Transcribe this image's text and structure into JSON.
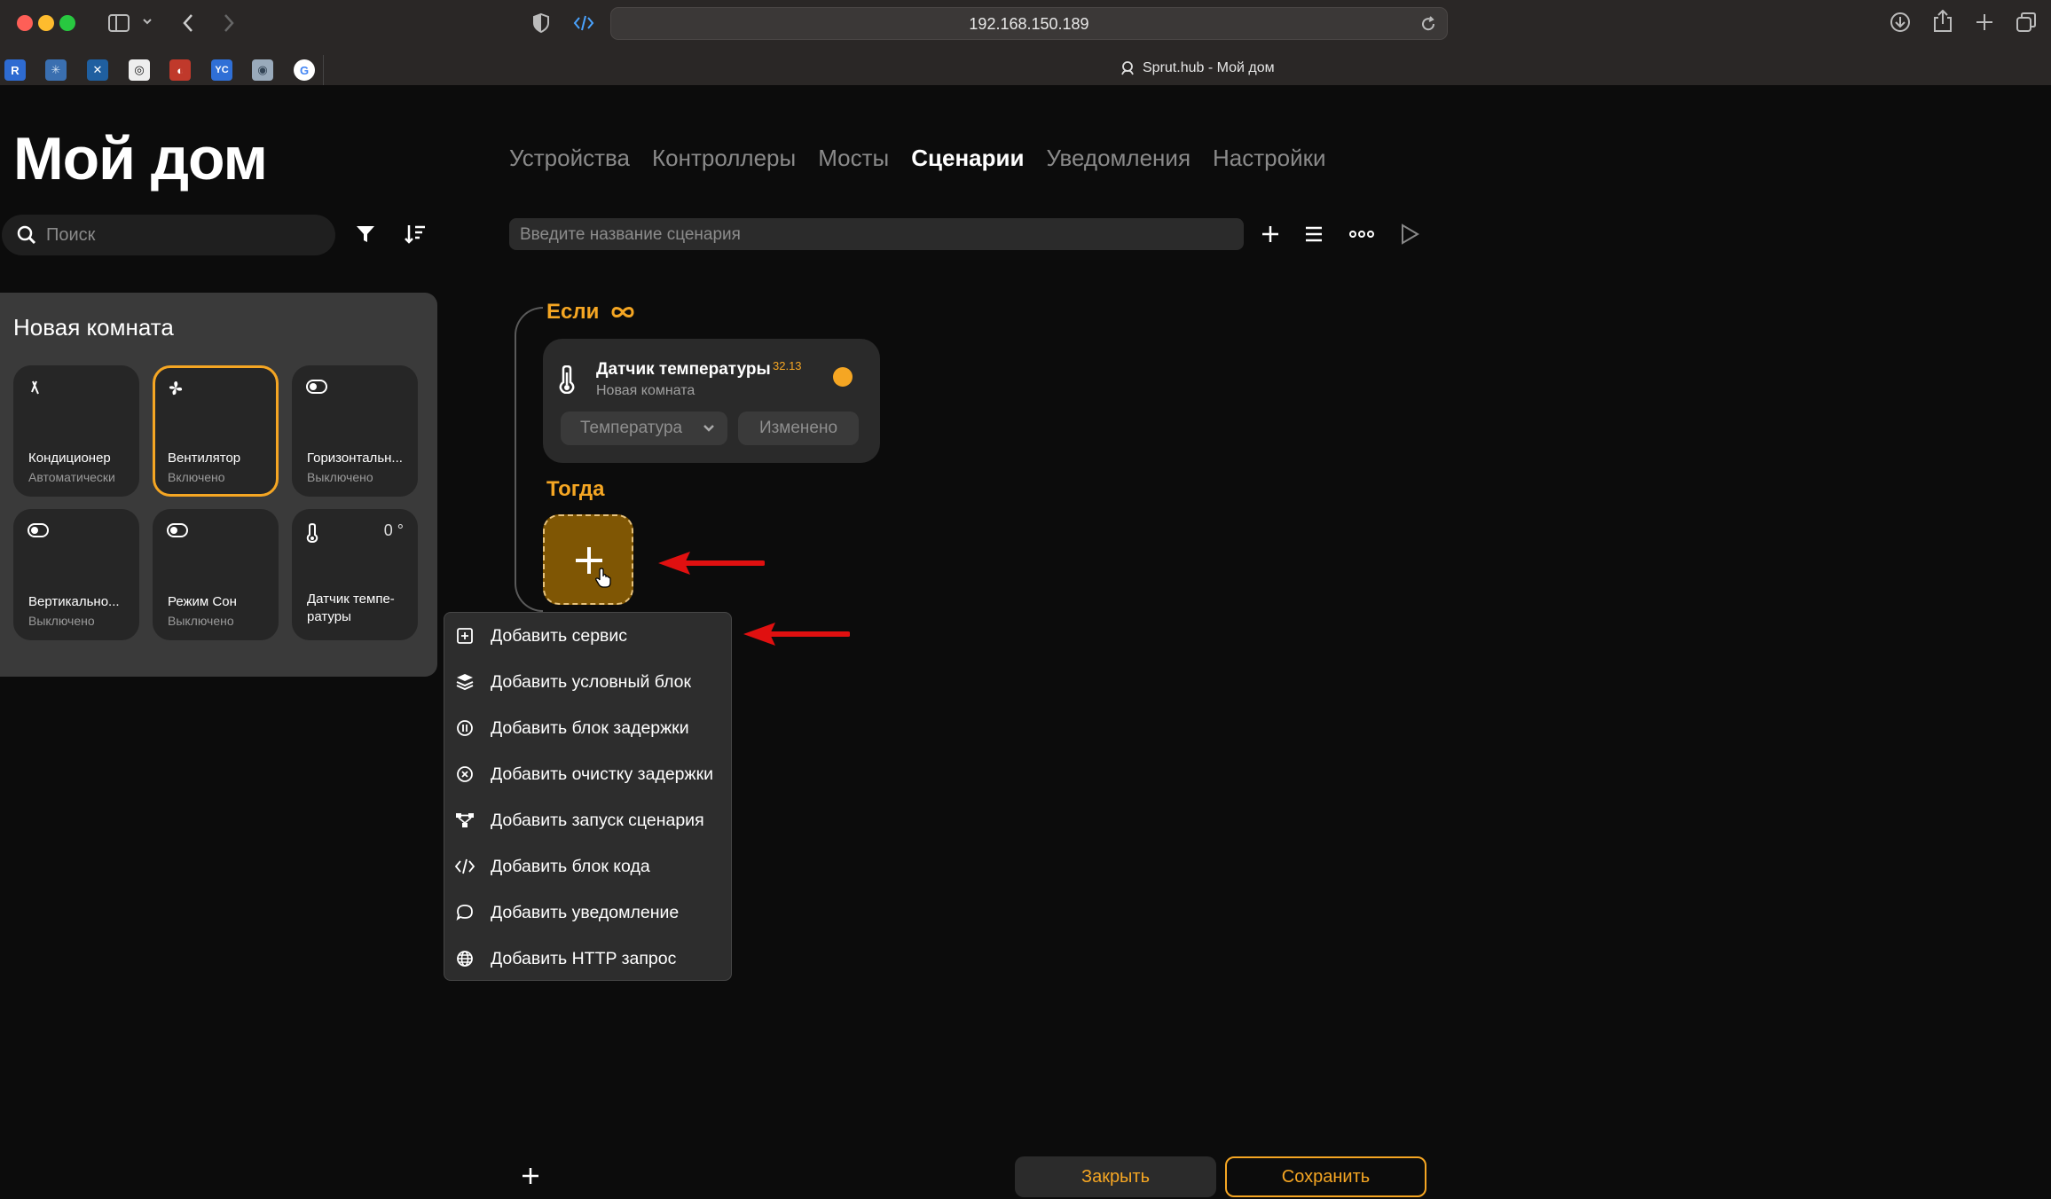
{
  "browser": {
    "url": "192.168.150.189",
    "tab_title": "Sprut.hub - Мой дом",
    "bookmarks": [
      "R",
      "✳",
      "✕",
      "◎",
      "◐",
      "YC",
      "◉",
      "G"
    ]
  },
  "app": {
    "title": "Мой дом",
    "nav": {
      "devices": "Устройства",
      "controllers": "Контроллеры",
      "bridges": "Мосты",
      "scenarios": "Сценарии",
      "notifications": "Уведомления",
      "settings": "Настройки"
    },
    "search_placeholder": "Поиск",
    "scenario_placeholder": "Введите название сценария"
  },
  "room": {
    "title": "Новая комната",
    "tiles": [
      {
        "name": "Кондиционер",
        "state": "Автоматически",
        "icon": "air-conditioner-icon"
      },
      {
        "name": "Вентилятор",
        "state": "Включено",
        "icon": "fan-icon",
        "active": true
      },
      {
        "name": "Горизонтальн...",
        "state": "Выключено",
        "icon": "toggle-icon"
      },
      {
        "name": "Вертикально...",
        "state": "Выключено",
        "icon": "toggle-icon"
      },
      {
        "name": "Режим Сон",
        "state": "Выключено",
        "icon": "toggle-icon"
      },
      {
        "name": "Датчик темпе-ратуры",
        "state": "",
        "value": "0 °",
        "icon": "thermometer-icon"
      }
    ]
  },
  "scenario": {
    "if_label": "Если",
    "then_label": "Тогда",
    "condition": {
      "device": "Датчик температуры",
      "value": "32.13",
      "room": "Новая комната",
      "characteristic": "Температура",
      "trigger": "Изменено"
    }
  },
  "menu": {
    "items": [
      {
        "label": "Добавить сервис",
        "icon": "plus-square-icon"
      },
      {
        "label": "Добавить условный блок",
        "icon": "layers-icon"
      },
      {
        "label": "Добавить блок задержки",
        "icon": "pause-circle-icon"
      },
      {
        "label": "Добавить очистку задержки",
        "icon": "x-circle-icon"
      },
      {
        "label": "Добавить запуск сценария",
        "icon": "flow-icon"
      },
      {
        "label": "Добавить блок кода",
        "icon": "code-icon"
      },
      {
        "label": "Добавить уведомление",
        "icon": "chat-bubble-icon"
      },
      {
        "label": "Добавить HTTP запрос",
        "icon": "globe-icon"
      }
    ]
  },
  "footer": {
    "close": "Закрыть",
    "save": "Сохранить"
  },
  "colors": {
    "accent": "#f5a623",
    "arrow": "#e01010",
    "background": "#0c0c0c"
  }
}
